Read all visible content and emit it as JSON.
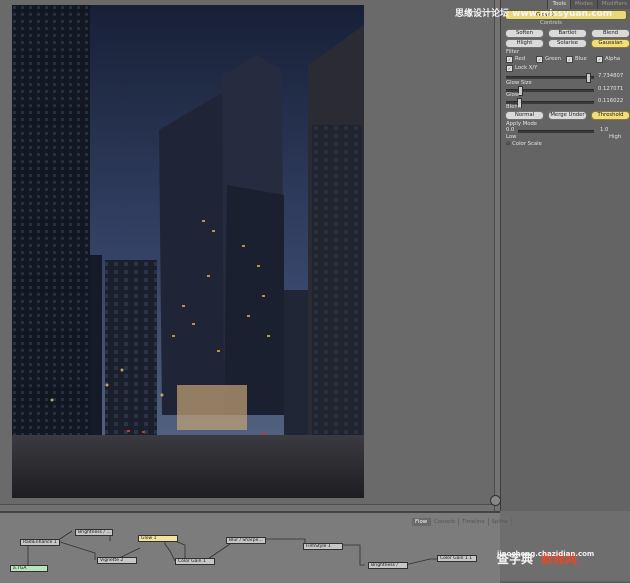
{
  "watermark_top": "思缘设计论坛 www.missyuan.com",
  "watermark_bottom_title": "查字典",
  "watermark_bottom_sub": "教程网",
  "watermark_bottom_url": "jiaocheng.chazidian.com",
  "panel": {
    "tabs": [
      "Tools",
      "Modes",
      "Modifiers"
    ],
    "tool_name": "Glow 1",
    "controls_label": "Controls",
    "row1": [
      "Soften",
      "Bartlet",
      "Blend"
    ],
    "row2": [
      "Hlight",
      "Solarise",
      "Gaussian"
    ],
    "filter_label": "Filter",
    "filters": [
      "Red",
      "Green",
      "Blue",
      "Alpha"
    ],
    "lock_label": "Lock X/Y",
    "glow_size_label": "Glow Size",
    "glow_label": "Glow",
    "blend_label": "Blend",
    "v1": "7.734807",
    "v2": "0.127071",
    "v3": "0.116022",
    "blend_modes": [
      "Normal",
      "Merge Under",
      "Threshold"
    ],
    "apply_mode": "Apply Mode",
    "range_low_val": "0.0",
    "range_high_val": "1.0",
    "range_low": "Low",
    "range_high": "High",
    "color_scale": "Color Scale"
  },
  "node_tabs": [
    "Flow",
    "Console",
    "Timeline",
    "Spline"
  ],
  "nodes": {
    "bg": "Brightness / ...",
    "loader": "RadiEnhance 1",
    "tga": "a.TGA",
    "vignette": "Vignette 2",
    "glow": "Glow 1",
    "colorgain1": "Color Gain 1",
    "blur": "Blur / Sharpe...",
    "filmstyle": "FilmStyle 1",
    "bright2": "Brightness /",
    "colorgain2": "Color Gain 1 1"
  }
}
